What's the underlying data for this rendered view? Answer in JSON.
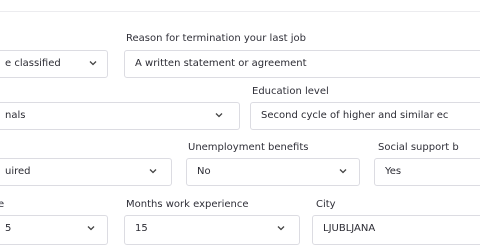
{
  "rows": [
    {
      "fields": [
        {
          "value": "e classified"
        },
        {
          "label": "Reason for termination your last job",
          "value": "A written statement or agreement"
        }
      ]
    },
    {
      "fields": [
        {
          "value": "nals"
        },
        {
          "label": "Education level",
          "value": "Second cycle of higher and similar ec"
        }
      ]
    },
    {
      "fields": [
        {
          "value": "uired"
        },
        {
          "label": "Unemployment benefits",
          "value": "No"
        },
        {
          "label": "Social support b",
          "value": "Yes"
        }
      ]
    },
    {
      "fields": [
        {
          "label": "e",
          "value": "5"
        },
        {
          "label": "Months work experience",
          "value": "15"
        },
        {
          "label": "City",
          "value": "LJUBLJANA"
        }
      ]
    }
  ],
  "icons": {
    "dropdown": "chevron-down-icon"
  }
}
